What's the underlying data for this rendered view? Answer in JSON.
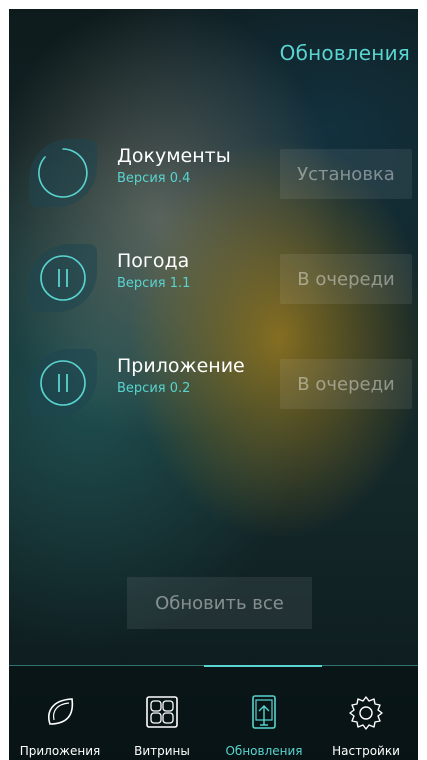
{
  "header": {
    "title": "Обновления"
  },
  "updates": [
    {
      "name": "Документы",
      "version": "Версия 0.4",
      "state": "Установка",
      "icon": "spinner-icon"
    },
    {
      "name": "Погода",
      "version": "Версия 1.1",
      "state": "В очереди",
      "icon": "pause-icon"
    },
    {
      "name": "Приложение",
      "version": "Версия 0.2",
      "state": "В очереди",
      "icon": "pause-icon"
    }
  ],
  "update_all_label": "Обновить все",
  "nav": [
    {
      "label": "Приложения",
      "icon": "leaf-icon",
      "active": false
    },
    {
      "label": "Витрины",
      "icon": "grid-icon",
      "active": false
    },
    {
      "label": "Обновления",
      "icon": "phone-update-icon",
      "active": true
    },
    {
      "label": "Настройки",
      "icon": "gear-icon",
      "active": false
    }
  ],
  "colors": {
    "accent": "#59d4d0",
    "text": "#ffffff",
    "muted": "#8a9a9a"
  }
}
